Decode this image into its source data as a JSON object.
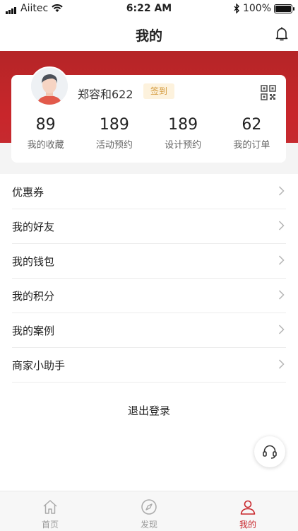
{
  "status_bar": {
    "carrier": "Aiitec",
    "time": "6:22 AM",
    "battery": "100%"
  },
  "header": {
    "title": "我的"
  },
  "profile": {
    "username": "郑容和622",
    "checkin_label": "签到",
    "stats": [
      {
        "value": "89",
        "label": "我的收藏"
      },
      {
        "value": "189",
        "label": "活动预约"
      },
      {
        "value": "189",
        "label": "设计预约"
      },
      {
        "value": "62",
        "label": "我的订单"
      }
    ]
  },
  "menu": {
    "items": [
      {
        "label": "优惠券"
      },
      {
        "label": "我的好友"
      },
      {
        "label": "我的钱包"
      },
      {
        "label": "我的积分"
      },
      {
        "label": "我的案例"
      },
      {
        "label": "商家小助手"
      }
    ]
  },
  "logout_label": "退出登录",
  "tabbar": {
    "tabs": [
      {
        "label": "首页",
        "icon": "home-icon",
        "active": false
      },
      {
        "label": "发现",
        "icon": "compass-icon",
        "active": false
      },
      {
        "label": "我的",
        "icon": "user-icon",
        "active": true
      }
    ]
  },
  "colors": {
    "brand_red": "#c8262b",
    "checkin_bg": "#fdf2dd",
    "checkin_text": "#d49a3d",
    "tab_inactive": "#999999",
    "tab_active": "#c8262b"
  }
}
